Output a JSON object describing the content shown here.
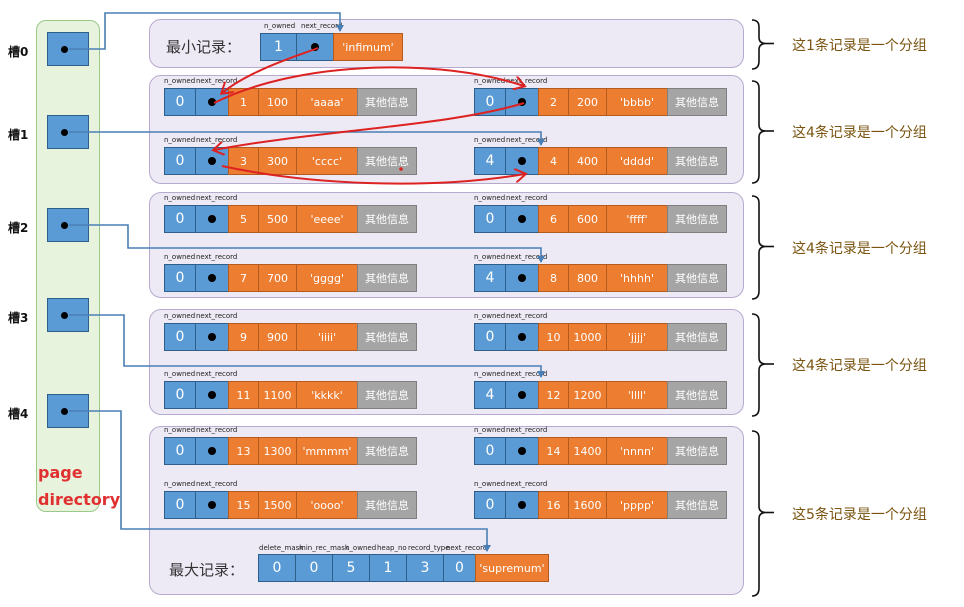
{
  "directory": {
    "label_line1": "page",
    "label_line2": "directory",
    "slots": [
      "槽0",
      "槽1",
      "槽2",
      "槽3",
      "槽4"
    ]
  },
  "header_labels": {
    "n_owned": "n_owned",
    "next_record": "next_record",
    "supremum_fields": [
      "delete_mask",
      "min_rec_mask",
      "n_owned",
      "heap_no",
      "record_type",
      "next_record"
    ]
  },
  "infimum": {
    "label": "最小记录：",
    "n_owned": "1",
    "value": "'infimum'"
  },
  "supremum": {
    "label": "最大记录：",
    "fields": [
      "0",
      "0",
      "5",
      "1",
      "3",
      "0"
    ],
    "value": "'supremum'"
  },
  "records": [
    {
      "n_owned": "0",
      "id": "1",
      "num": "100",
      "str": "'aaaa'",
      "other": "其他信息"
    },
    {
      "n_owned": "0",
      "id": "2",
      "num": "200",
      "str": "'bbbb'",
      "other": "其他信息"
    },
    {
      "n_owned": "0",
      "id": "3",
      "num": "300",
      "str": "'cccc'",
      "other": "其他信息"
    },
    {
      "n_owned": "4",
      "id": "4",
      "num": "400",
      "str": "'dddd'",
      "other": "其他信息"
    },
    {
      "n_owned": "0",
      "id": "5",
      "num": "500",
      "str": "'eeee'",
      "other": "其他信息"
    },
    {
      "n_owned": "0",
      "id": "6",
      "num": "600",
      "str": "'ffff'",
      "other": "其他信息"
    },
    {
      "n_owned": "0",
      "id": "7",
      "num": "700",
      "str": "'gggg'",
      "other": "其他信息"
    },
    {
      "n_owned": "4",
      "id": "8",
      "num": "800",
      "str": "'hhhh'",
      "other": "其他信息"
    },
    {
      "n_owned": "0",
      "id": "9",
      "num": "900",
      "str": "'iiii'",
      "other": "其他信息"
    },
    {
      "n_owned": "0",
      "id": "10",
      "num": "1000",
      "str": "'jjjj'",
      "other": "其他信息"
    },
    {
      "n_owned": "0",
      "id": "11",
      "num": "1100",
      "str": "'kkkk'",
      "other": "其他信息"
    },
    {
      "n_owned": "4",
      "id": "12",
      "num": "1200",
      "str": "'llll'",
      "other": "其他信息"
    },
    {
      "n_owned": "0",
      "id": "13",
      "num": "1300",
      "str": "'mmmm'",
      "other": "其他信息"
    },
    {
      "n_owned": "0",
      "id": "14",
      "num": "1400",
      "str": "'nnnn'",
      "other": "其他信息"
    },
    {
      "n_owned": "0",
      "id": "15",
      "num": "1500",
      "str": "'oooo'",
      "other": "其他信息"
    },
    {
      "n_owned": "0",
      "id": "16",
      "num": "1600",
      "str": "'pppp'",
      "other": "其他信息"
    }
  ],
  "group_notes": [
    "这1条记录是一个分组",
    "这4条记录是一个分组",
    "这4条记录是一个分组",
    "这4条记录是一个分组",
    "这5条记录是一个分组"
  ],
  "colors": {
    "field_blue": "#5b9bd5",
    "field_orange": "#ed7d31",
    "field_gray": "#a5a5a5",
    "slot_link": "#4a7fb5",
    "record_chain": "#dd2222",
    "directory_label": "#e03030"
  }
}
